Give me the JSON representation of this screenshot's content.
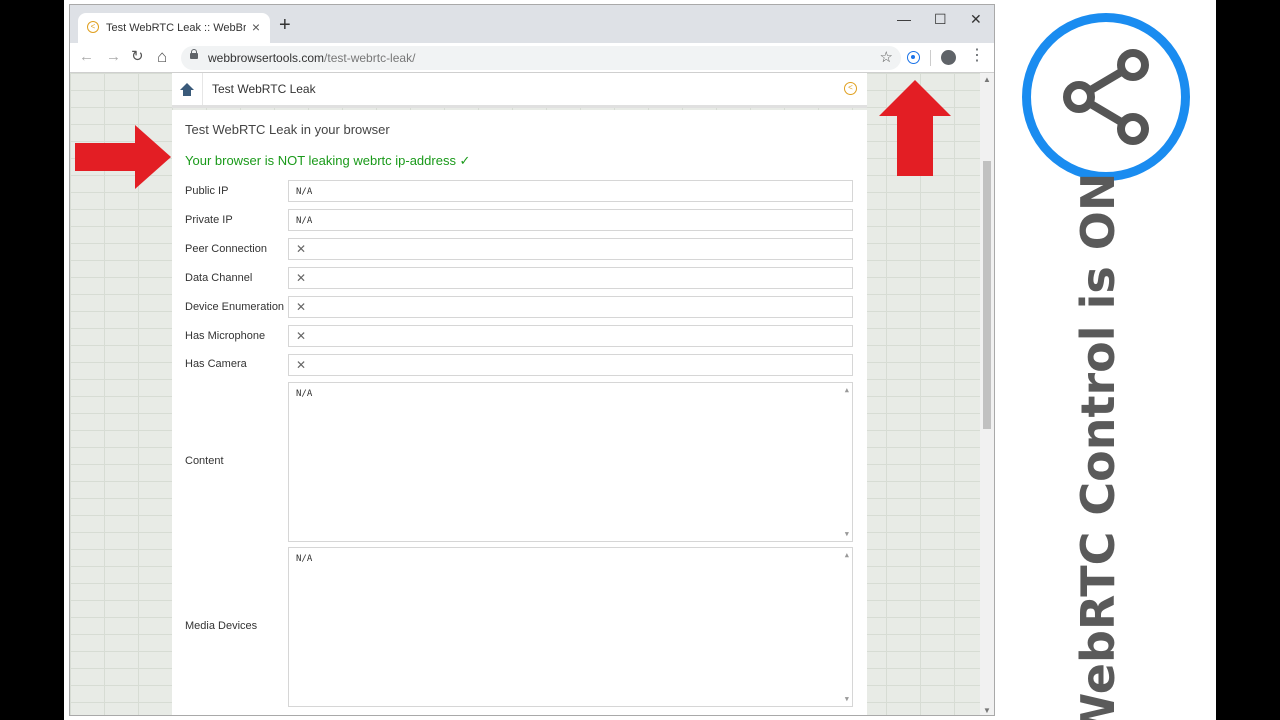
{
  "browser": {
    "tab_title": "Test WebRTC Leak :: WebBrowser",
    "tab_close": "×",
    "new_tab": "+",
    "minimize": "—",
    "maximize": "☐",
    "close": "✕",
    "back": "←",
    "forward": "→",
    "reload": "↻",
    "home": "⌂",
    "url_host": "webbrowsertools.com",
    "url_path": "/test-webrtc-leak/",
    "bookmark": "☆",
    "menu": "⋮"
  },
  "page": {
    "header_title": "Test WebRTC Leak",
    "card_title": "Test WebRTC Leak in your browser",
    "status": "Your browser is NOT leaking webrtc ip-address ✓",
    "rows": [
      {
        "label": "Public IP",
        "value": "N/A"
      },
      {
        "label": "Private IP",
        "value": "N/A"
      },
      {
        "label": "Peer Connection",
        "value": "✕"
      },
      {
        "label": "Data Channel",
        "value": "✕"
      },
      {
        "label": "Device Enumeration",
        "value": "✕"
      },
      {
        "label": "Has Microphone",
        "value": "✕"
      },
      {
        "label": "Has Camera",
        "value": "✕"
      }
    ],
    "content_label": "Content",
    "content_value": "N/A",
    "media_label": "Media Devices",
    "media_value": "N/A"
  },
  "side": {
    "caption": "WebRTC Control is ON",
    "badge_color": "#1a8cf0",
    "icon": "share-icon"
  },
  "colors": {
    "arrow": "#e31e24",
    "status_green": "#1a9a1a"
  }
}
